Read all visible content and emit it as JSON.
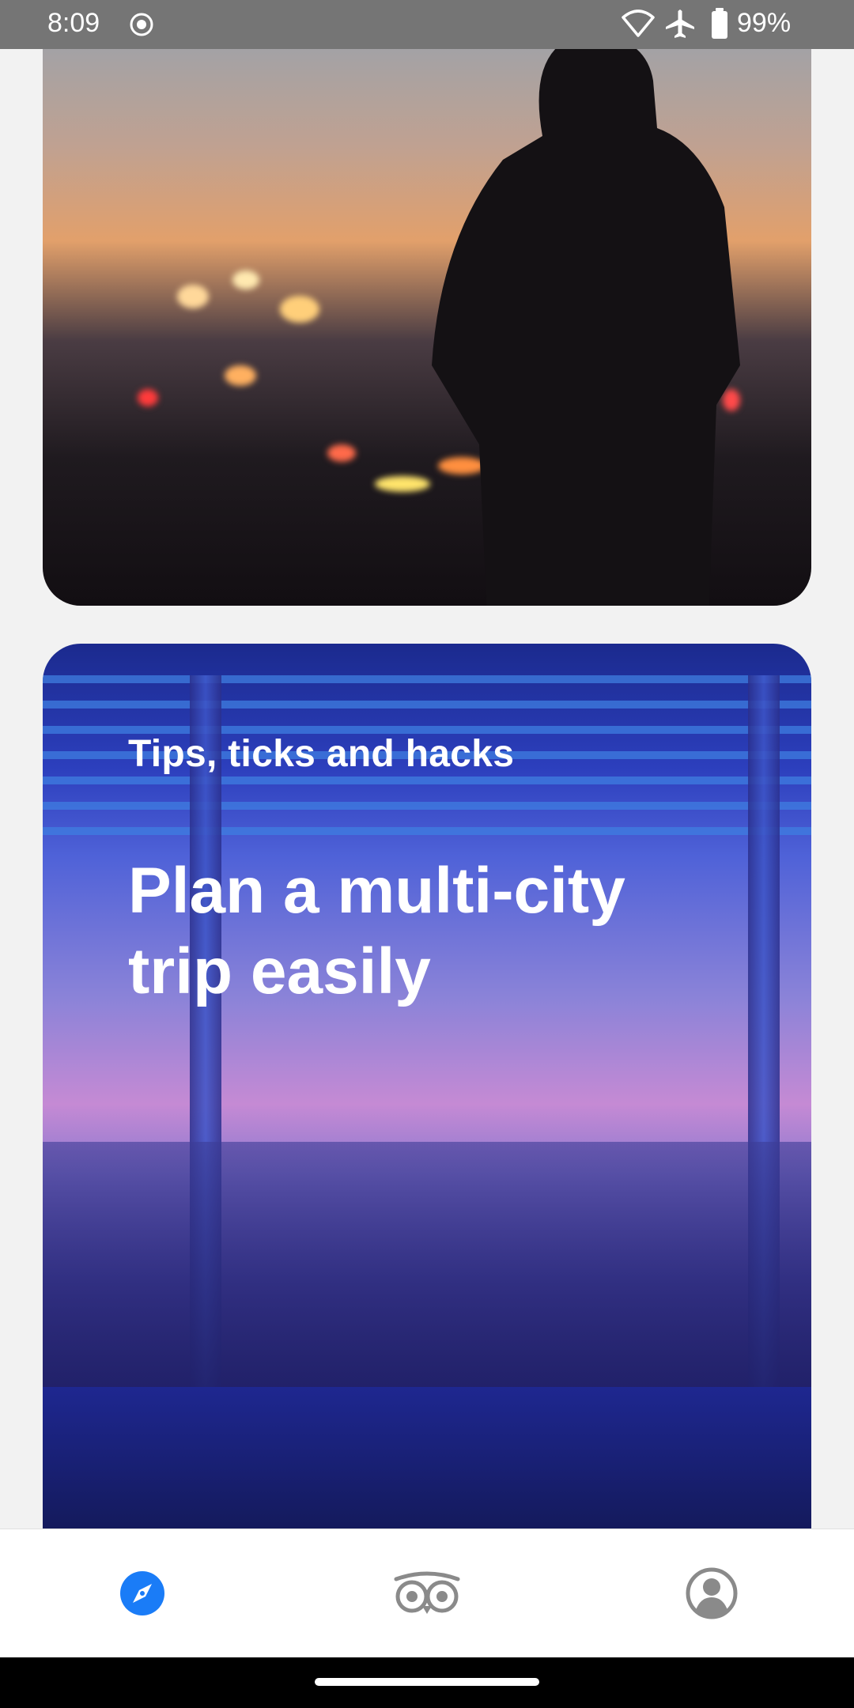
{
  "status_bar": {
    "time": "8:09",
    "battery_text": "99%",
    "icons": [
      "screen-record-icon",
      "wifi-icon",
      "airplane-mode-icon",
      "battery-icon"
    ]
  },
  "cards": [
    {
      "image": "city-skyline-dusk-woman-silhouette"
    },
    {
      "image": "night-city-window-cat-illustration",
      "eyebrow": "Tips, ticks and hacks",
      "title": "Plan a multi-city trip easily"
    }
  ],
  "bottom_nav": {
    "items": [
      {
        "icon": "compass-icon",
        "active": true
      },
      {
        "icon": "owl-icon",
        "active": false
      },
      {
        "icon": "account-icon",
        "active": false
      }
    ],
    "active_color": "#1a7cf7",
    "inactive_color": "#8a8a8a"
  }
}
